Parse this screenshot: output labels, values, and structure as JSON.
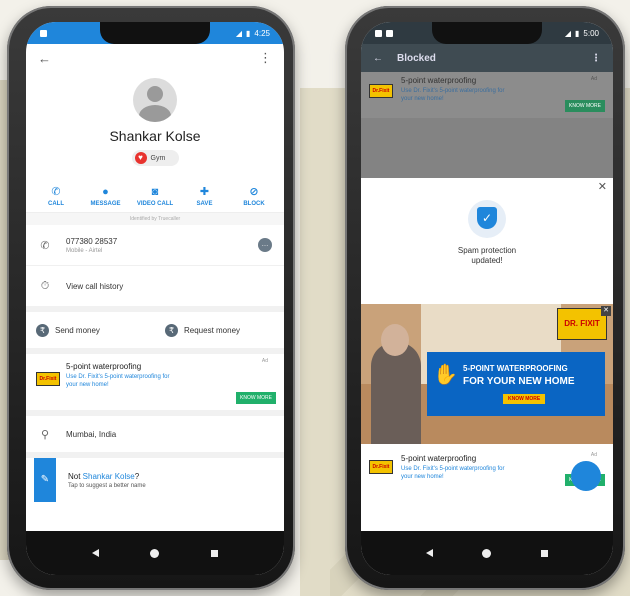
{
  "phone1": {
    "status_time": "4:25",
    "contact": {
      "name": "Shankar Kolse",
      "tag": "Gym"
    },
    "actions": [
      {
        "label": "CALL",
        "icon": "phone-icon"
      },
      {
        "label": "MESSAGE",
        "icon": "message-icon"
      },
      {
        "label": "VIDEO CALL",
        "icon": "video-call-icon"
      },
      {
        "label": "SAVE",
        "icon": "add-person-icon"
      },
      {
        "label": "BLOCK",
        "icon": "block-icon"
      }
    ],
    "identified_by": "Identified by Truecaller",
    "phone": {
      "number": "077380 28537",
      "type": "Mobile - Airtel"
    },
    "call_history": "View call history",
    "money": {
      "send": "Send money",
      "request": "Request money"
    },
    "ad": {
      "title": "5-point waterproofing",
      "subtitle": "Use Dr. Fixit's 5-point waterproofing for your new home!",
      "label": "Ad",
      "cta": "KNOW MORE"
    },
    "location": "Mumbai, India",
    "suggest": {
      "prefix": "Not ",
      "name": "Shankar Kolse",
      "suffix": "?",
      "subtitle": "Tap to suggest a better name"
    }
  },
  "phone2": {
    "status_time": "5:00",
    "title": "Blocked",
    "blocked_ad": {
      "title": "5-point waterproofing",
      "subtitle": "Use Dr. Fixit's 5-point waterproofing for your new home!",
      "label": "Ad",
      "cta": "KNOW MORE"
    },
    "dialog": {
      "message_line1": "Spam protection",
      "message_line2": "updated!"
    },
    "banner": {
      "brand": "DR. FIXIT",
      "headline1": "5-POINT WATERPROOFING",
      "headline2": "FOR YOUR NEW HOME",
      "cta": "KNOW MORE"
    },
    "sheet_ad": {
      "title": "5-point waterproofing",
      "subtitle": "Use Dr. Fixit's 5-point waterproofing for your new home!",
      "label": "Ad",
      "cta": "KNOW MORE"
    }
  },
  "colors": {
    "accent": "#1f86db",
    "cta_green": "#21b06b",
    "block_bar": "#3f4b52"
  }
}
